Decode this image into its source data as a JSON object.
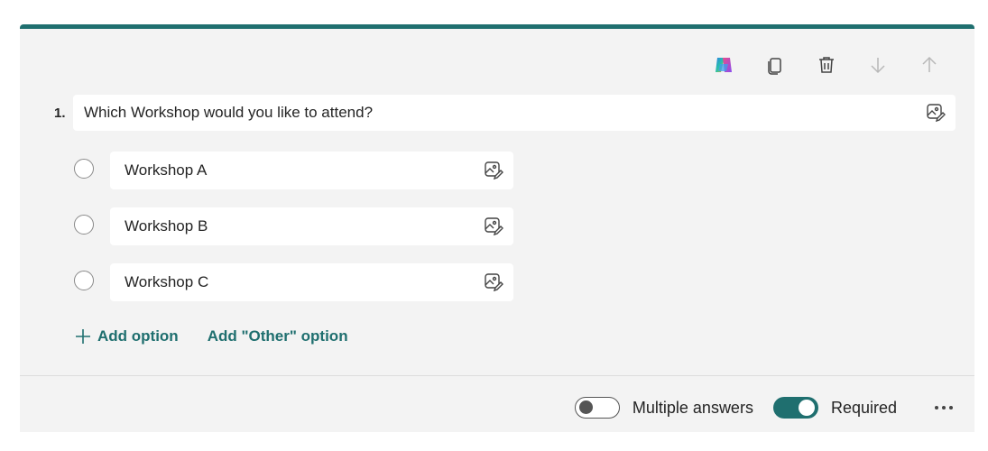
{
  "question": {
    "number": "1.",
    "text": "Which Workshop would you like to attend?"
  },
  "options": [
    {
      "label": "Workshop A"
    },
    {
      "label": "Workshop B"
    },
    {
      "label": "Workshop C"
    }
  ],
  "actions": {
    "add_option": "Add option",
    "add_other": "Add \"Other\" option"
  },
  "footer": {
    "multiple_answers_label": "Multiple answers",
    "multiple_answers_on": false,
    "required_label": "Required",
    "required_on": true
  },
  "toolbar": {
    "icons": [
      "copilot-icon",
      "copy-icon",
      "delete-icon",
      "move-down-icon",
      "move-up-icon"
    ]
  },
  "colors": {
    "accent": "#1f6f6f",
    "card_bg": "#f3f3f3"
  }
}
